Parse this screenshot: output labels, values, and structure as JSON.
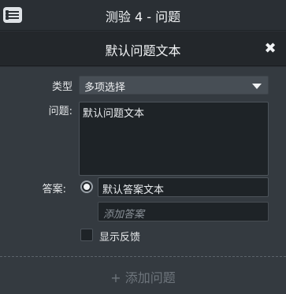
{
  "topbar": {
    "title": "测验 4 - 问题",
    "menu_icon": "list-menu-icon"
  },
  "header": {
    "title": "默认问题文本",
    "close_icon": "close-icon",
    "close_glyph": "✖"
  },
  "form": {
    "type_label": "类型",
    "type_value": "多项选择",
    "question_label": "问题:",
    "question_value": "默认问题文本",
    "answer_label": "答案:",
    "answer_value": "默认答案文本",
    "answer_selected": true,
    "add_answer_placeholder": "添加答案",
    "show_feedback_label": "显示反馈",
    "show_feedback_checked": false
  },
  "footer": {
    "add_question_label": "+ 添加问题"
  },
  "colors": {
    "background": "#343a40",
    "header": "#23272b",
    "field": "#1e2327",
    "muted": "#6e757c"
  }
}
